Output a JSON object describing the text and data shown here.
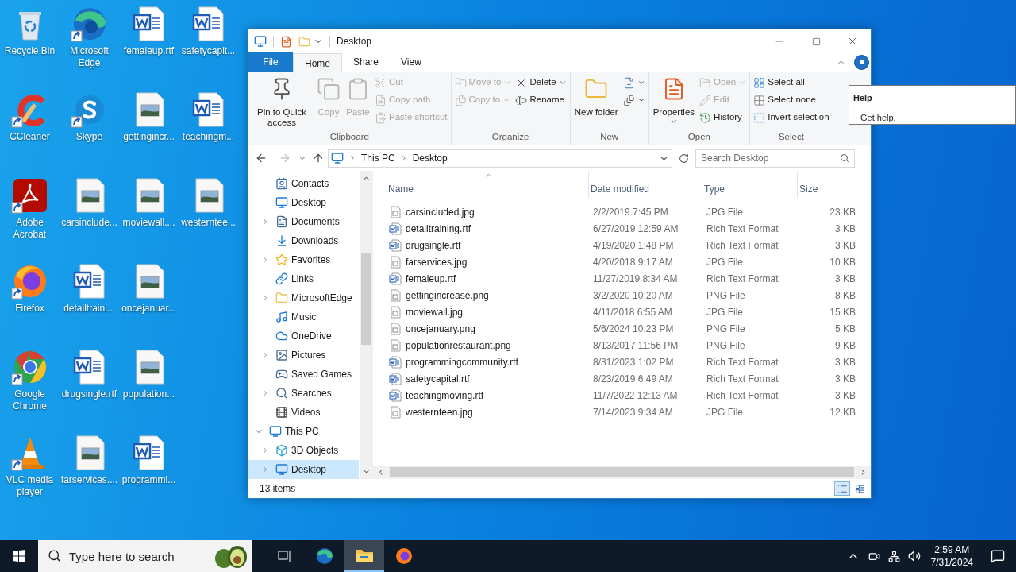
{
  "desktop": {
    "icons": [
      {
        "label": "Recycle Bin",
        "kind": "recycle",
        "shortcut": false
      },
      {
        "label": "CCleaner",
        "kind": "ccleaner",
        "shortcut": true
      },
      {
        "label": "Adobe Acrobat",
        "kind": "acrobat",
        "shortcut": true
      },
      {
        "label": "Firefox",
        "kind": "firefox",
        "shortcut": true
      },
      {
        "label": "Google Chrome",
        "kind": "chrome",
        "shortcut": true
      },
      {
        "label": "VLC media player",
        "kind": "vlc",
        "shortcut": true
      },
      {
        "label": "Microsoft Edge",
        "kind": "edge",
        "shortcut": true
      },
      {
        "label": "Skype",
        "kind": "skype",
        "shortcut": true
      },
      {
        "label": "carsinclude...",
        "kind": "image",
        "shortcut": false
      },
      {
        "label": "detailtraini...",
        "kind": "word",
        "shortcut": false
      },
      {
        "label": "drugsingle.rtf",
        "kind": "word",
        "shortcut": false
      },
      {
        "label": "farservices....",
        "kind": "image",
        "shortcut": false
      },
      {
        "label": "femaleup.rtf",
        "kind": "word",
        "shortcut": false
      },
      {
        "label": "gettingincr...",
        "kind": "image",
        "shortcut": false
      },
      {
        "label": "moviewall....",
        "kind": "image",
        "shortcut": false
      },
      {
        "label": "oncejanuar...",
        "kind": "image",
        "shortcut": false
      },
      {
        "label": "population...",
        "kind": "image",
        "shortcut": false
      },
      {
        "label": "programmi...",
        "kind": "word",
        "shortcut": false
      },
      {
        "label": "safetycapit...",
        "kind": "word",
        "shortcut": false
      },
      {
        "label": "teachingm...",
        "kind": "word",
        "shortcut": false
      },
      {
        "label": "westerntee...",
        "kind": "image",
        "shortcut": false
      }
    ]
  },
  "window": {
    "title": "Desktop",
    "tabs": [
      {
        "label": "File",
        "kind": "file",
        "selected": false
      },
      {
        "label": "Home",
        "kind": "tab",
        "selected": true
      },
      {
        "label": "Share",
        "kind": "tab",
        "selected": false
      },
      {
        "label": "View",
        "kind": "tab",
        "selected": false
      }
    ],
    "ribbon": {
      "groups": [
        {
          "label": "Clipboard",
          "columns": [
            {
              "kind": "large",
              "items": [
                {
                  "label": "Pin to Quick access",
                  "kind": "pin",
                  "disabled": false,
                  "dropdown": false
                }
              ]
            },
            {
              "kind": "large",
              "items": [
                {
                  "label": "Copy",
                  "kind": "copy",
                  "disabled": true,
                  "dropdown": false
                }
              ]
            },
            {
              "kind": "large",
              "items": [
                {
                  "label": "Paste",
                  "kind": "paste",
                  "disabled": true,
                  "dropdown": false
                }
              ]
            },
            {
              "kind": "stack",
              "items": [
                {
                  "label": "Cut",
                  "kind": "cut",
                  "disabled": true,
                  "dropdown": false
                },
                {
                  "label": "Copy path",
                  "kind": "copypath",
                  "disabled": true,
                  "dropdown": false
                },
                {
                  "label": "Paste shortcut",
                  "kind": "pasteshortcut",
                  "disabled": true,
                  "dropdown": false
                }
              ]
            }
          ]
        },
        {
          "label": "Organize",
          "columns": [
            {
              "kind": "stack",
              "items": [
                {
                  "label": "Move to",
                  "kind": "moveto",
                  "disabled": true,
                  "dropdown": true
                },
                {
                  "label": "Copy to",
                  "kind": "copyto",
                  "disabled": true,
                  "dropdown": true
                }
              ]
            },
            {
              "kind": "stack",
              "items": [
                {
                  "label": "Delete",
                  "kind": "delete",
                  "disabled": false,
                  "dropdown": true
                },
                {
                  "label": "Rename",
                  "kind": "rename",
                  "disabled": false,
                  "dropdown": false
                }
              ]
            }
          ]
        },
        {
          "label": "New",
          "columns": [
            {
              "kind": "large",
              "items": [
                {
                  "label": "New folder",
                  "kind": "newfolder",
                  "disabled": false,
                  "dropdown": false
                }
              ]
            },
            {
              "kind": "stack",
              "items": [
                {
                  "kind": "newitem",
                  "disabled": false,
                  "dropdown": true
                },
                {
                  "kind": "easyaccess",
                  "disabled": false,
                  "dropdown": true
                }
              ]
            }
          ]
        },
        {
          "label": "Open",
          "columns": [
            {
              "kind": "large",
              "items": [
                {
                  "label": "Properties",
                  "kind": "properties",
                  "disabled": false,
                  "dropdown": true
                }
              ]
            },
            {
              "kind": "stack",
              "items": [
                {
                  "label": "Open",
                  "kind": "open",
                  "disabled": true,
                  "dropdown": true
                },
                {
                  "label": "Edit",
                  "kind": "edit",
                  "disabled": true,
                  "dropdown": false
                },
                {
                  "label": "History",
                  "kind": "history",
                  "disabled": false,
                  "dropdown": false
                }
              ]
            }
          ]
        },
        {
          "label": "Select",
          "columns": [
            {
              "kind": "stack",
              "items": [
                {
                  "label": "Select all",
                  "kind": "selectall",
                  "disabled": false,
                  "dropdown": false
                },
                {
                  "label": "Select none",
                  "kind": "selectnone",
                  "disabled": false,
                  "dropdown": false
                },
                {
                  "label": "Invert selection",
                  "kind": "invert",
                  "disabled": false,
                  "dropdown": false
                }
              ]
            }
          ]
        }
      ]
    },
    "address": {
      "back_disabled": false,
      "forward_disabled": true,
      "crumbs": [
        "This PC",
        "Desktop"
      ]
    },
    "search": {
      "placeholder": "Search Desktop"
    },
    "nav": {
      "folder_items": [
        {
          "label": "Contacts",
          "kind": "contacts",
          "has_children": false,
          "expanded": false,
          "selected": false
        },
        {
          "label": "Desktop",
          "kind": "desktop",
          "has_children": false,
          "expanded": false,
          "selected": false
        },
        {
          "label": "Documents",
          "kind": "documents",
          "has_children": true,
          "expanded": false,
          "selected": false
        },
        {
          "label": "Downloads",
          "kind": "downloads",
          "has_children": false,
          "expanded": false,
          "selected": false
        },
        {
          "label": "Favorites",
          "kind": "favorites",
          "has_children": true,
          "expanded": false,
          "selected": false
        },
        {
          "label": "Links",
          "kind": "links",
          "has_children": false,
          "expanded": false,
          "selected": false
        },
        {
          "label": "MicrosoftEdge",
          "kind": "folder",
          "has_children": true,
          "expanded": false,
          "selected": false
        },
        {
          "label": "Music",
          "kind": "music",
          "has_children": false,
          "expanded": false,
          "selected": false
        },
        {
          "label": "OneDrive",
          "kind": "onedrive",
          "has_children": false,
          "expanded": false,
          "selected": false
        },
        {
          "label": "Pictures",
          "kind": "pictures",
          "has_children": true,
          "expanded": false,
          "selected": false
        },
        {
          "label": "Saved Games",
          "kind": "games",
          "has_children": false,
          "expanded": false,
          "selected": false
        },
        {
          "label": "Searches",
          "kind": "searches",
          "has_children": true,
          "expanded": false,
          "selected": false
        },
        {
          "label": "Videos",
          "kind": "videos",
          "has_children": false,
          "expanded": false,
          "selected": false
        }
      ],
      "tree": [
        {
          "label": "This PC",
          "kind": "pc",
          "has_children": true,
          "expanded": true,
          "selected": false,
          "children": [
            {
              "label": "3D Objects",
              "kind": "cube",
              "has_children": true,
              "expanded": false,
              "selected": false
            },
            {
              "label": "Desktop",
              "kind": "desktop",
              "has_children": true,
              "expanded": false,
              "selected": true
            }
          ]
        }
      ]
    },
    "table": {
      "columns": [
        {
          "label": "Name",
          "sorted": true
        },
        {
          "label": "Date modified",
          "sorted": false
        },
        {
          "label": "Type",
          "sorted": false
        },
        {
          "label": "Size",
          "sorted": false
        }
      ],
      "rows": [
        {
          "name": "carsincluded.jpg",
          "kind": "image",
          "date": "2/2/2019 7:45 PM",
          "type": "JPG File",
          "size": "23 KB"
        },
        {
          "name": "detailtraining.rtf",
          "kind": "word",
          "date": "6/27/2019 12:59 AM",
          "type": "Rich Text Format",
          "size": "3 KB"
        },
        {
          "name": "drugsingle.rtf",
          "kind": "word",
          "date": "4/19/2020 1:48 PM",
          "type": "Rich Text Format",
          "size": "3 KB"
        },
        {
          "name": "farservices.jpg",
          "kind": "image",
          "date": "4/20/2018 9:17 AM",
          "type": "JPG File",
          "size": "10 KB"
        },
        {
          "name": "femaleup.rtf",
          "kind": "word",
          "date": "11/27/2019 8:34 AM",
          "type": "Rich Text Format",
          "size": "3 KB"
        },
        {
          "name": "gettingincrease.png",
          "kind": "image",
          "date": "3/2/2020 10:20 AM",
          "type": "PNG File",
          "size": "8 KB"
        },
        {
          "name": "moviewall.jpg",
          "kind": "image",
          "date": "4/11/2018 6:55 AM",
          "type": "JPG File",
          "size": "15 KB"
        },
        {
          "name": "oncejanuary.png",
          "kind": "image",
          "date": "5/6/2024 10:23 PM",
          "type": "PNG File",
          "size": "5 KB"
        },
        {
          "name": "populationrestaurant.png",
          "kind": "image",
          "date": "8/13/2017 11:56 PM",
          "type": "PNG File",
          "size": "9 KB"
        },
        {
          "name": "programmingcommunity.rtf",
          "kind": "word",
          "date": "8/31/2023 1:02 PM",
          "type": "Rich Text Format",
          "size": "3 KB"
        },
        {
          "name": "safetycapital.rtf",
          "kind": "word",
          "date": "8/23/2019 6:49 AM",
          "type": "Rich Text Format",
          "size": "3 KB"
        },
        {
          "name": "teachingmoving.rtf",
          "kind": "word",
          "date": "11/7/2022 12:13 AM",
          "type": "Rich Text Format",
          "size": "3 KB"
        },
        {
          "name": "westernteen.jpg",
          "kind": "image",
          "date": "7/14/2023 9:34 AM",
          "type": "JPG File",
          "size": "12 KB"
        }
      ]
    },
    "status_bar": {
      "count": "13 items",
      "views": [
        {
          "kind": "details",
          "selected": true
        },
        {
          "kind": "large",
          "selected": false
        }
      ]
    }
  },
  "tooltip": {
    "title": "Help",
    "text": "Get help."
  },
  "taskbar": {
    "search": {
      "placeholder": "Type here to search"
    },
    "apps": [
      {
        "kind": "taskview",
        "active": false
      },
      {
        "kind": "edge",
        "active": false
      },
      {
        "kind": "explorer",
        "active": true
      },
      {
        "kind": "firefox",
        "active": false
      }
    ],
    "time": "2:59 AM",
    "date": "7/31/2024"
  }
}
